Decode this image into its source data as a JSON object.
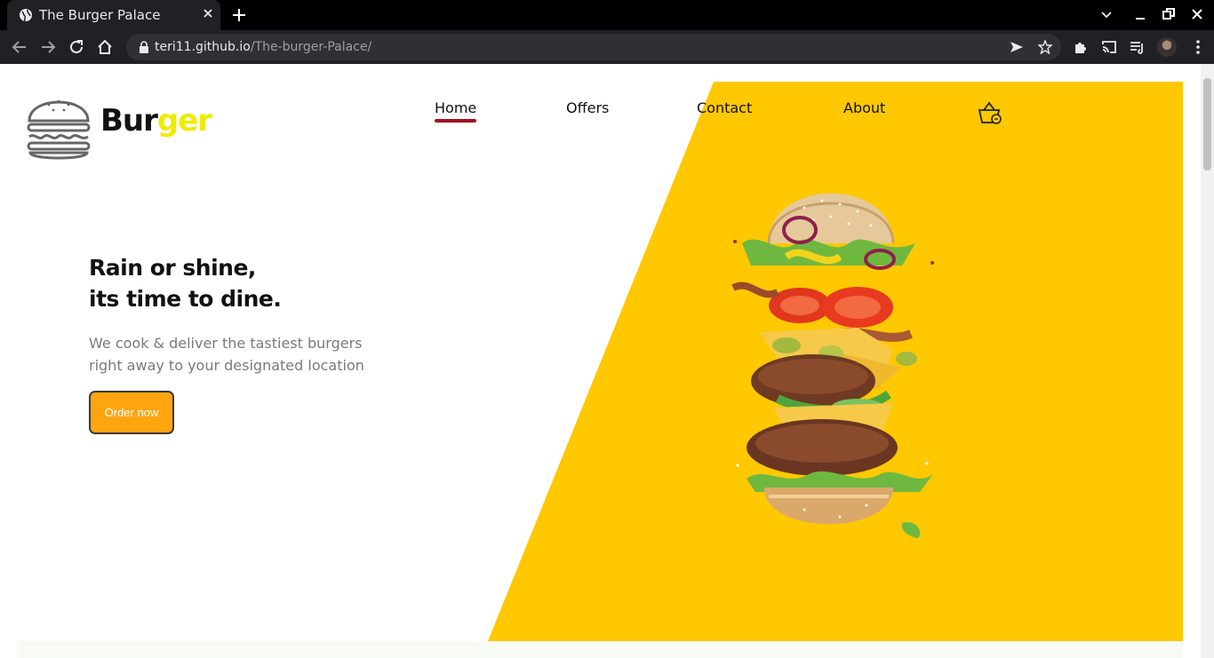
{
  "browser": {
    "tab_title": "The Burger Palace",
    "url_host": "teri11.github.io",
    "url_path": "/The-burger-Palace/"
  },
  "site": {
    "logo_part1": "Bur",
    "logo_part2": "ger",
    "nav": [
      {
        "label": "Home",
        "active": true
      },
      {
        "label": "Offers"
      },
      {
        "label": "Contact"
      },
      {
        "label": "About"
      }
    ],
    "hero": {
      "headline_line1": "Rain or shine,",
      "headline_line2": "its time to dine.",
      "sub_line1": "We cook & deliver the tastiest burgers",
      "sub_line2": "right away to your designated location",
      "cta_label": "Order now"
    }
  },
  "colors": {
    "accent_yellow": "#ffc800",
    "logo_yellow": "#f0ea00",
    "button_orange": "#ffa50f",
    "nav_underline": "#a20f23"
  },
  "icons": {
    "cart": "shopping-basket-icon",
    "logo": "burger-logo-icon"
  }
}
